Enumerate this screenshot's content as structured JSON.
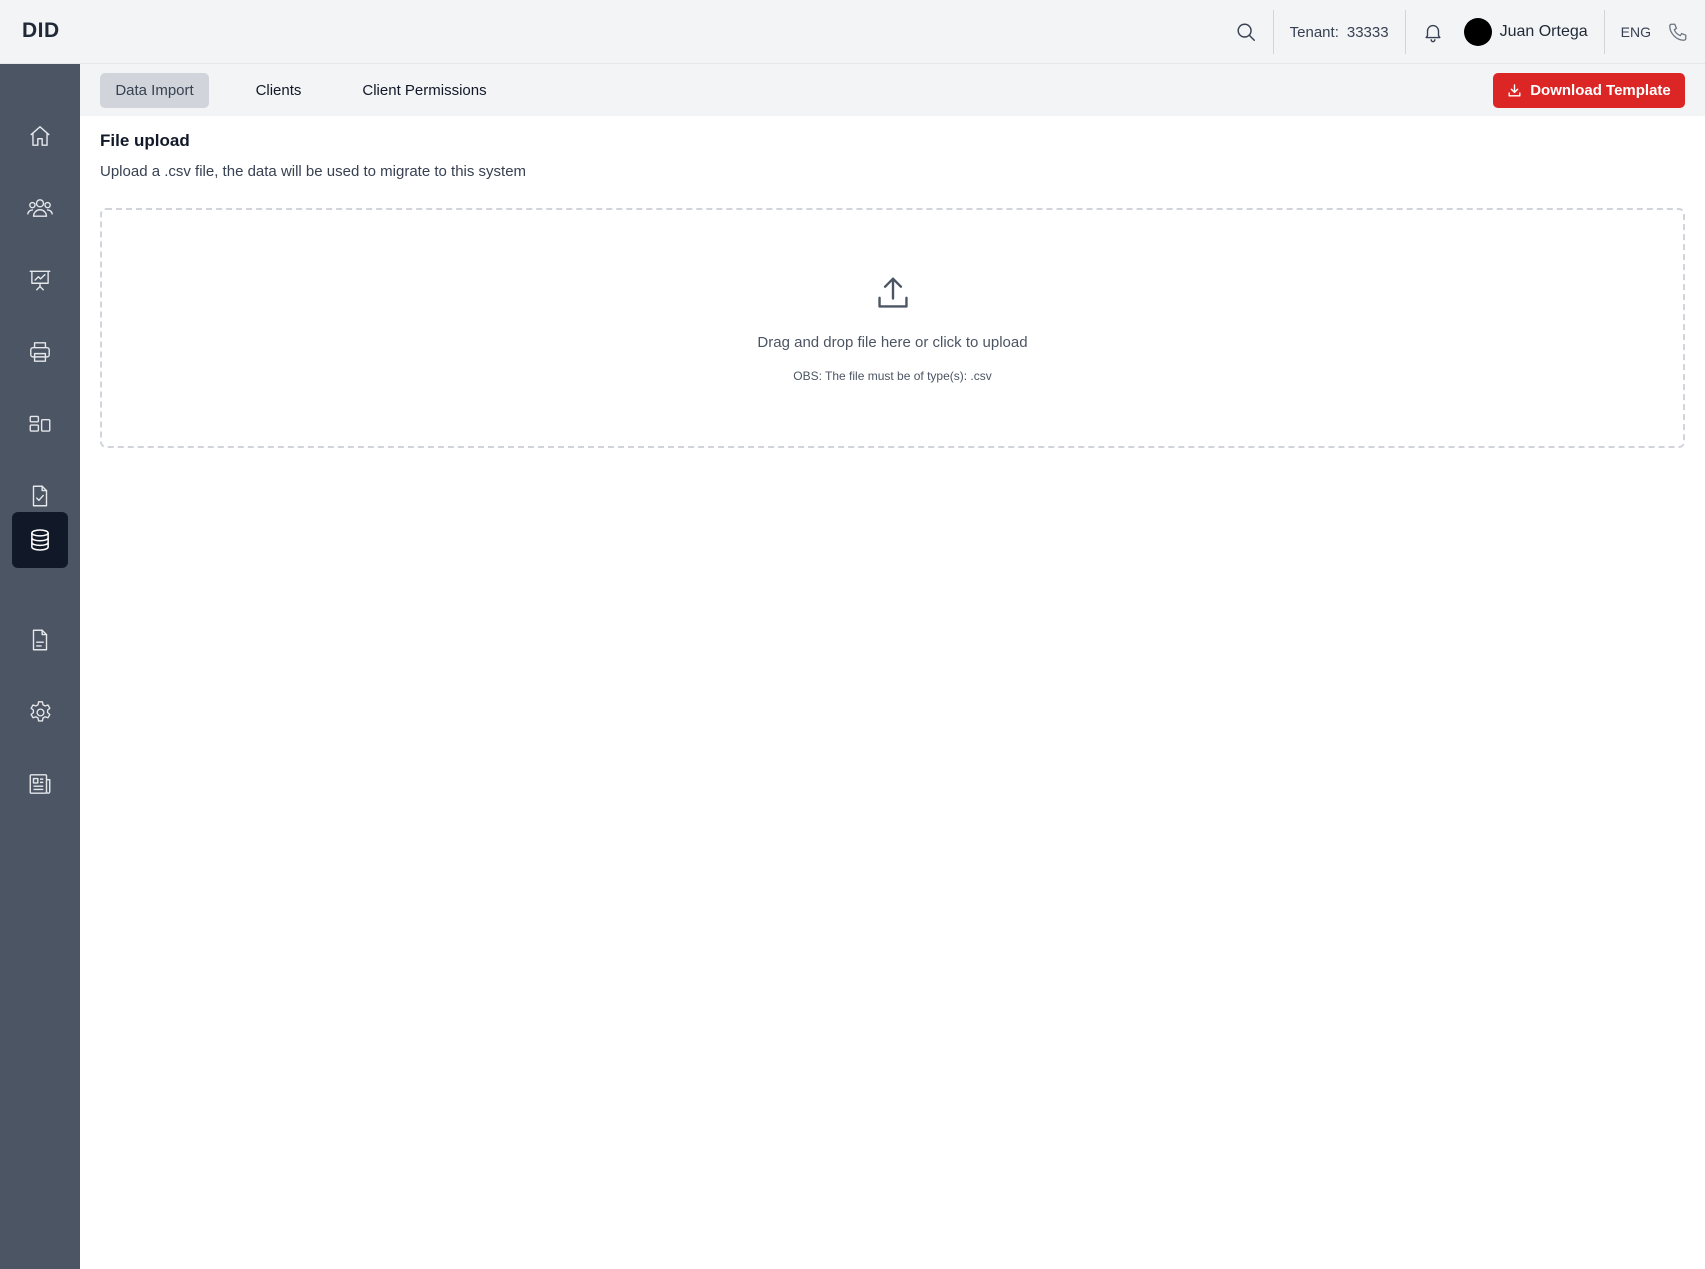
{
  "app": {
    "logo": "DID"
  },
  "header": {
    "tenant_label": "Tenant:",
    "tenant_value": "33333",
    "user_name": "Juan Ortega",
    "language": "ENG",
    "icons": [
      "search-icon",
      "bell-icon",
      "phone-icon"
    ]
  },
  "sidebar": {
    "items": [
      {
        "icon": "home-icon",
        "active": false
      },
      {
        "icon": "users-icon",
        "active": false
      },
      {
        "icon": "presentation-chart-icon",
        "active": false
      },
      {
        "icon": "printer-icon",
        "active": false
      },
      {
        "icon": "layout-icon",
        "active": false
      },
      {
        "icon": "file-check-icon",
        "active": false
      },
      {
        "icon": "database-icon",
        "active": true
      },
      {
        "icon": "file-text-icon",
        "active": false
      },
      {
        "icon": "settings-icon",
        "active": false
      },
      {
        "icon": "newspaper-icon",
        "active": false
      }
    ]
  },
  "tabs": [
    {
      "label": "Data Import",
      "active": true
    },
    {
      "label": "Clients",
      "active": false
    },
    {
      "label": "Client Permissions",
      "active": false
    }
  ],
  "actions": {
    "download_template": "Download Template"
  },
  "upload": {
    "title": "File upload",
    "description": "Upload a .csv file, the data will be used to migrate to this system",
    "dropzone_text": "Drag and drop file here or click to upload",
    "note": "OBS: The file must be of type(s): .csv"
  },
  "colors": {
    "sidebar_bg": "#4b5563",
    "sidebar_active": "#111827",
    "accent_red": "#dc2626",
    "topbar_bg": "#f3f4f6"
  }
}
